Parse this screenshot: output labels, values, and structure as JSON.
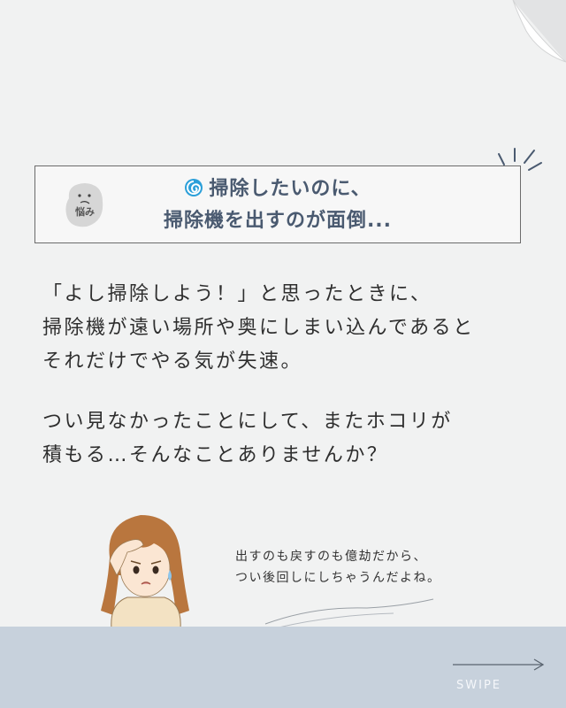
{
  "worry": {
    "badge_label": "悩み",
    "title_line1": "掃除したいのに、",
    "title_line2": "掃除機を出すのが面倒..."
  },
  "body": {
    "para1": [
      "「よし掃除しよう！」と思ったときに、",
      "掃除機が遠い場所や奥にしまい込んであると",
      "それだけでやる気が失速。"
    ],
    "para2": [
      "つい見なかったことにして、またホコリが",
      "積もる…そんなことありませんか？"
    ]
  },
  "speech": {
    "line1": "出すのも戻すのも億劫だから、",
    "line2": "つい後回しにしちゃうんだよね。"
  },
  "footer": {
    "swipe_label": "SWIPE"
  },
  "colors": {
    "accent": "#4a5a70",
    "band": "#c7d1dc",
    "swirl": "#2b9fd9"
  },
  "icons": [
    "page-curl-icon",
    "swirl-icon",
    "worried-face-icon",
    "swipe-arrow-icon"
  ]
}
